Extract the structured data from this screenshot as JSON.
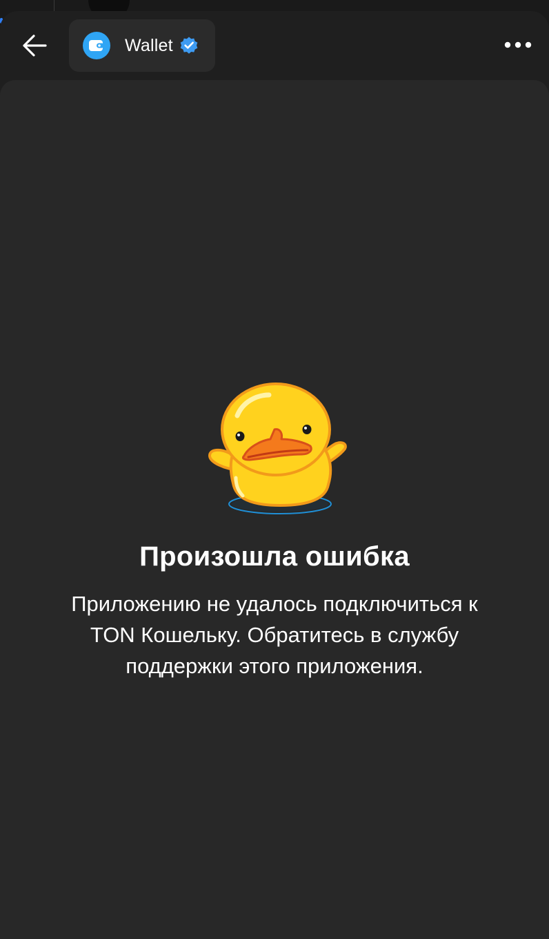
{
  "header": {
    "title": "Wallet",
    "back_icon": "arrow-left-icon",
    "app_icon": "wallet-icon",
    "verified_icon": "verified-badge-icon",
    "menu_icon": "more-horizontal-icon"
  },
  "error": {
    "illustration": "duck-shrug-icon",
    "title": "Произошла ошибка",
    "description": "Приложению не удалось подключиться к TON Кошельку. Обратитесь в службу поддержки этого приложения."
  },
  "colors": {
    "background": "#282828",
    "header": "#1f1f1f",
    "pill": "#2b2b2b",
    "accent": "#2fa5f5",
    "text": "#ffffff"
  }
}
